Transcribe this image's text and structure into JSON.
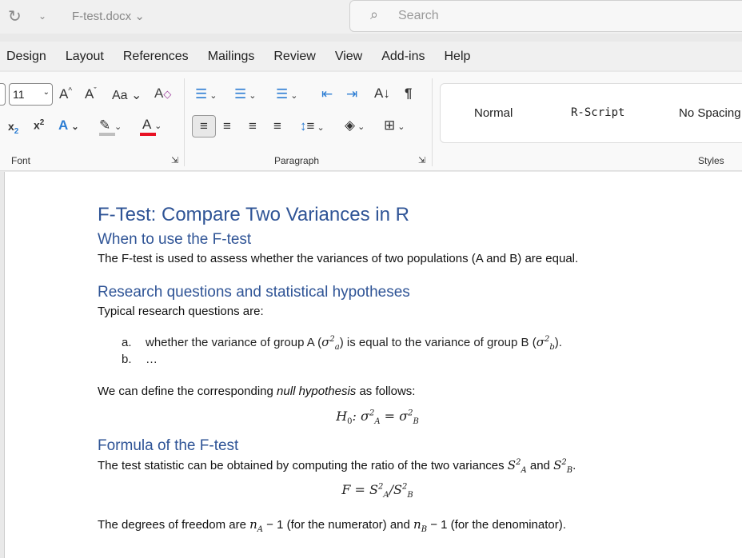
{
  "titlebar": {
    "filename": "F-test.docx",
    "search_placeholder": "Search"
  },
  "tabs": [
    "Design",
    "Layout",
    "References",
    "Mailings",
    "Review",
    "View",
    "Add-ins",
    "Help"
  ],
  "ribbon": {
    "font_size": "11",
    "groups": {
      "font": "Font",
      "paragraph": "Paragraph",
      "styles": "Styles"
    },
    "styles": [
      "Normal",
      "R-Script",
      "No Spacing"
    ],
    "change_case": "Aa",
    "font_color": "#e81123",
    "highlight_color": "#bfbfbf"
  },
  "doc": {
    "title": "F-Test: Compare Two Variances in R",
    "h_when": "When to use the F-test",
    "p_when": "The F-test is used to assess whether the variances of two populations (A and B) are equal.",
    "h_research": "Research questions and statistical hypotheses",
    "p_typical": "Typical research questions are:",
    "list": [
      {
        "marker": "a.",
        "pre": "whether the variance of group A (",
        "mid": ") is equal to the variance of group B (",
        "post": ")."
      },
      {
        "marker": "b.",
        "pre": "…"
      }
    ],
    "p_null_pre": "We can define the corresponding ",
    "p_null_em": "null hypothesis",
    "p_null_post": " as follows:",
    "h_formula": "Formula of the F-test",
    "p_stat_pre": "The test statistic can be obtained by computing the ratio of the two variances ",
    "p_stat_and": " and ",
    "p_df_pre": "The degrees of freedom are ",
    "p_df_mid": " (for the numerator) and ",
    "p_df_post": " (for the denominator)."
  }
}
